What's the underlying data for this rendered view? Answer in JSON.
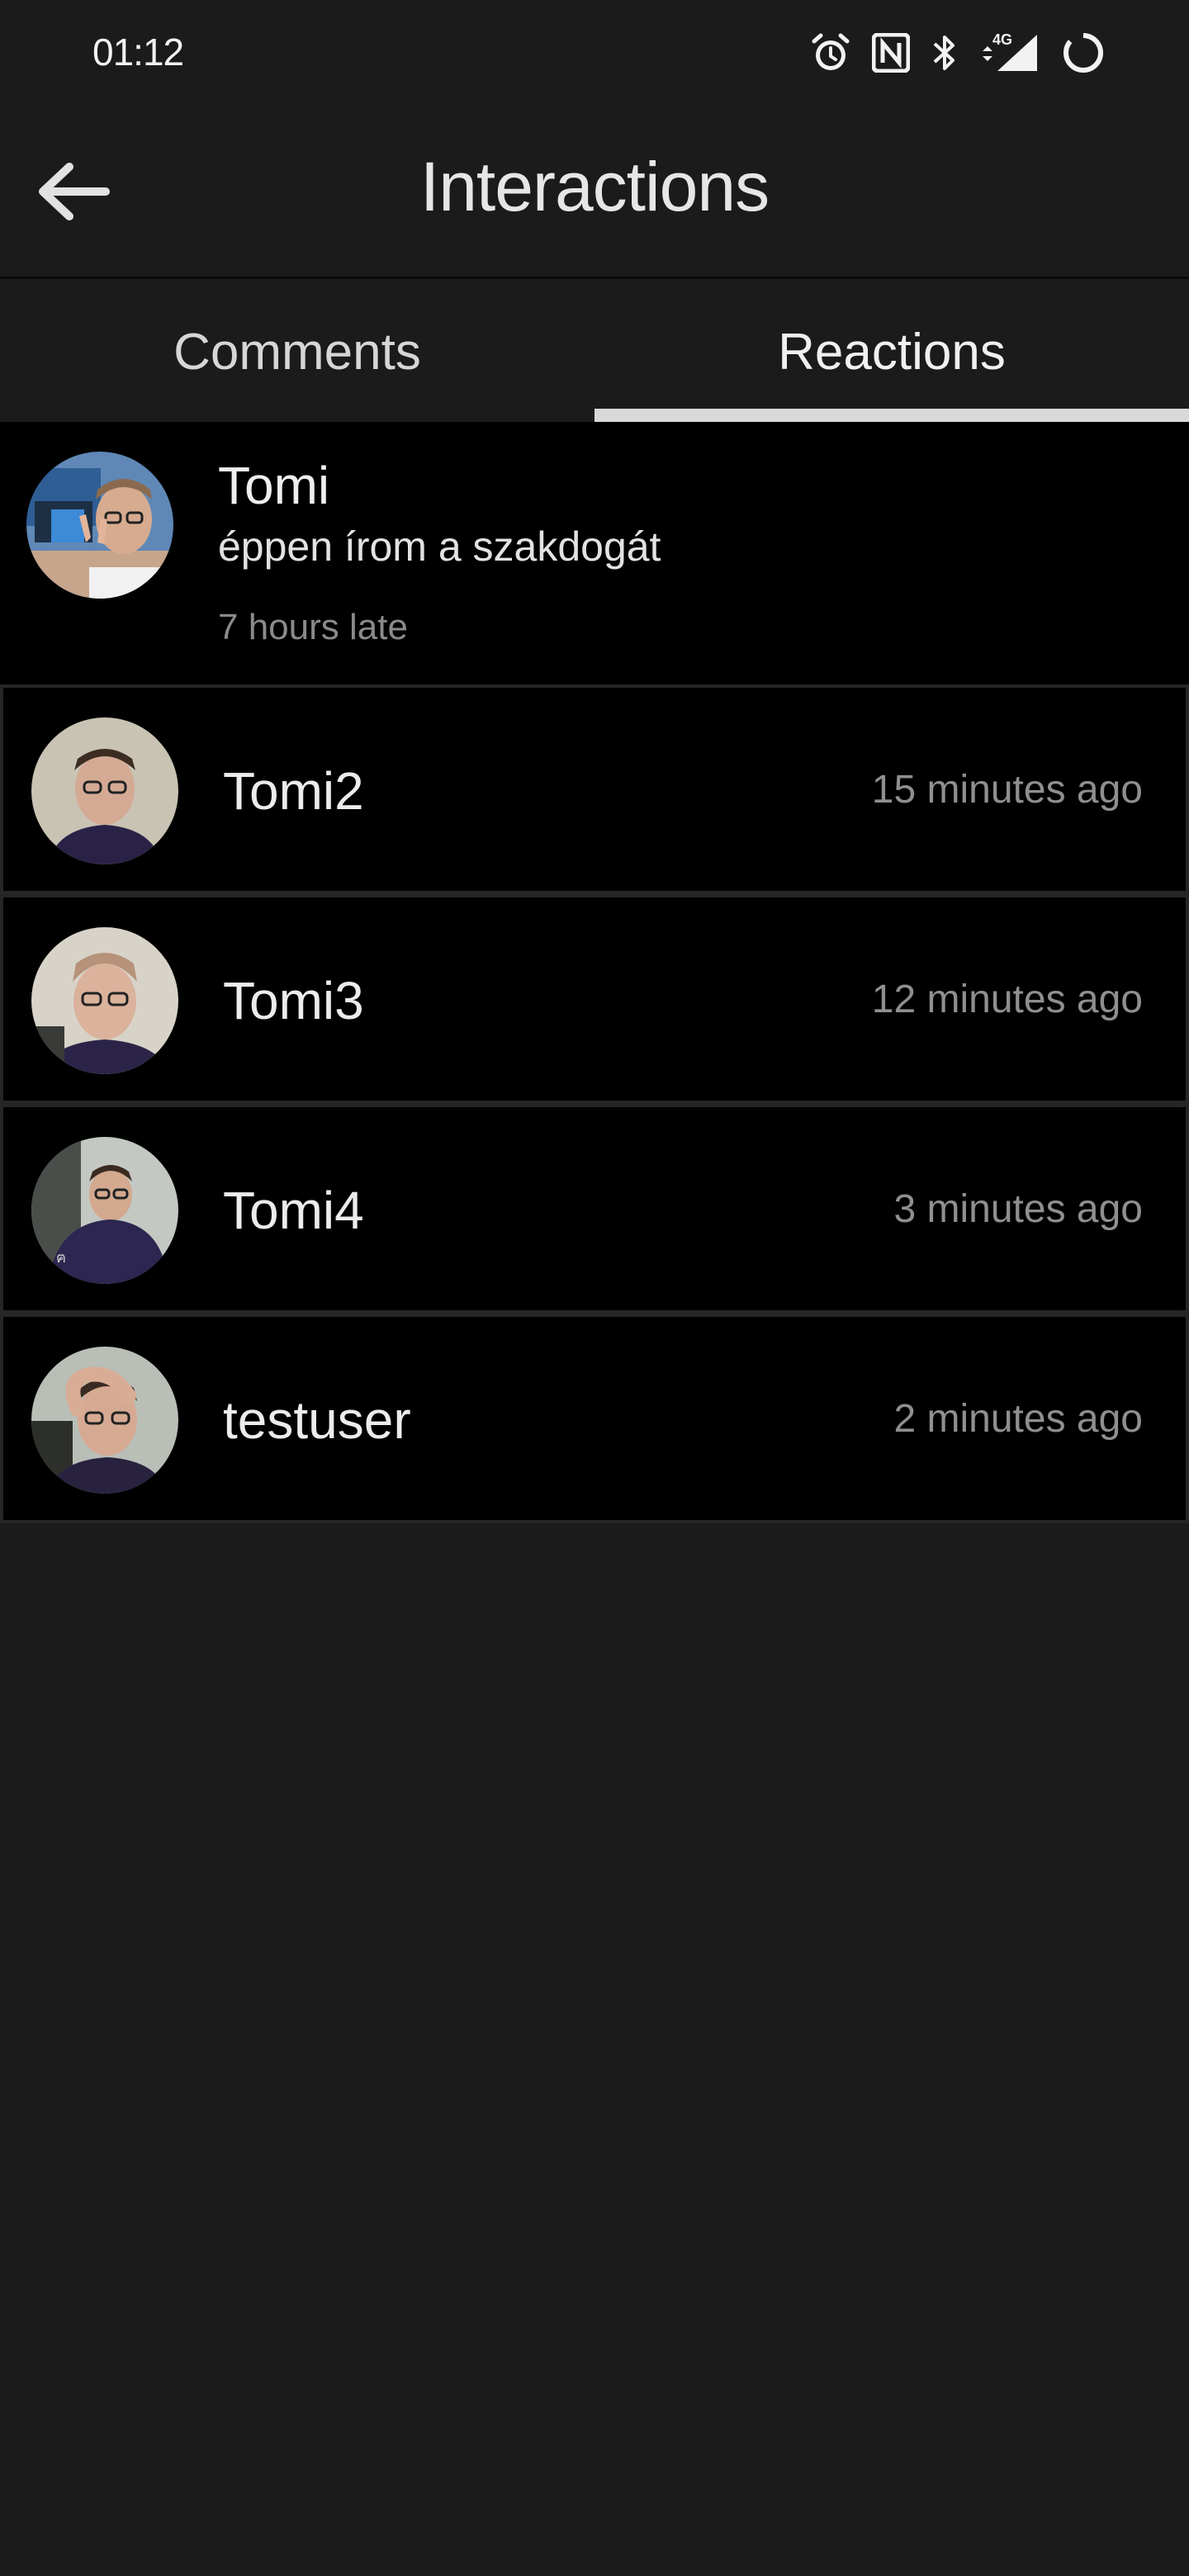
{
  "status_bar": {
    "time": "01:12",
    "icons": [
      "alarm-icon",
      "nfc-icon",
      "bluetooth-icon",
      "signal-4g-icon",
      "battery-ring-icon"
    ],
    "network_label": "4G"
  },
  "header": {
    "title": "Interactions",
    "back_icon": "arrow-left-icon"
  },
  "tabs": [
    {
      "label": "Comments",
      "selected": false
    },
    {
      "label": "Reactions",
      "selected": true
    }
  ],
  "post": {
    "author": "Tomi",
    "text": "éppen írom a szakdogát",
    "time": "7 hours late"
  },
  "reactions": [
    {
      "name": "Tomi2",
      "time": "15 minutes ago"
    },
    {
      "name": "Tomi3",
      "time": "12 minutes ago"
    },
    {
      "name": "Tomi4",
      "time": "3 minutes ago"
    },
    {
      "name": "testuser",
      "time": "2 minutes ago"
    }
  ],
  "colors": {
    "background": "#1b1b1b",
    "list_background": "#000000",
    "tab_indicator": "#d9d9d9",
    "secondary_text": "#8f8f8f"
  }
}
